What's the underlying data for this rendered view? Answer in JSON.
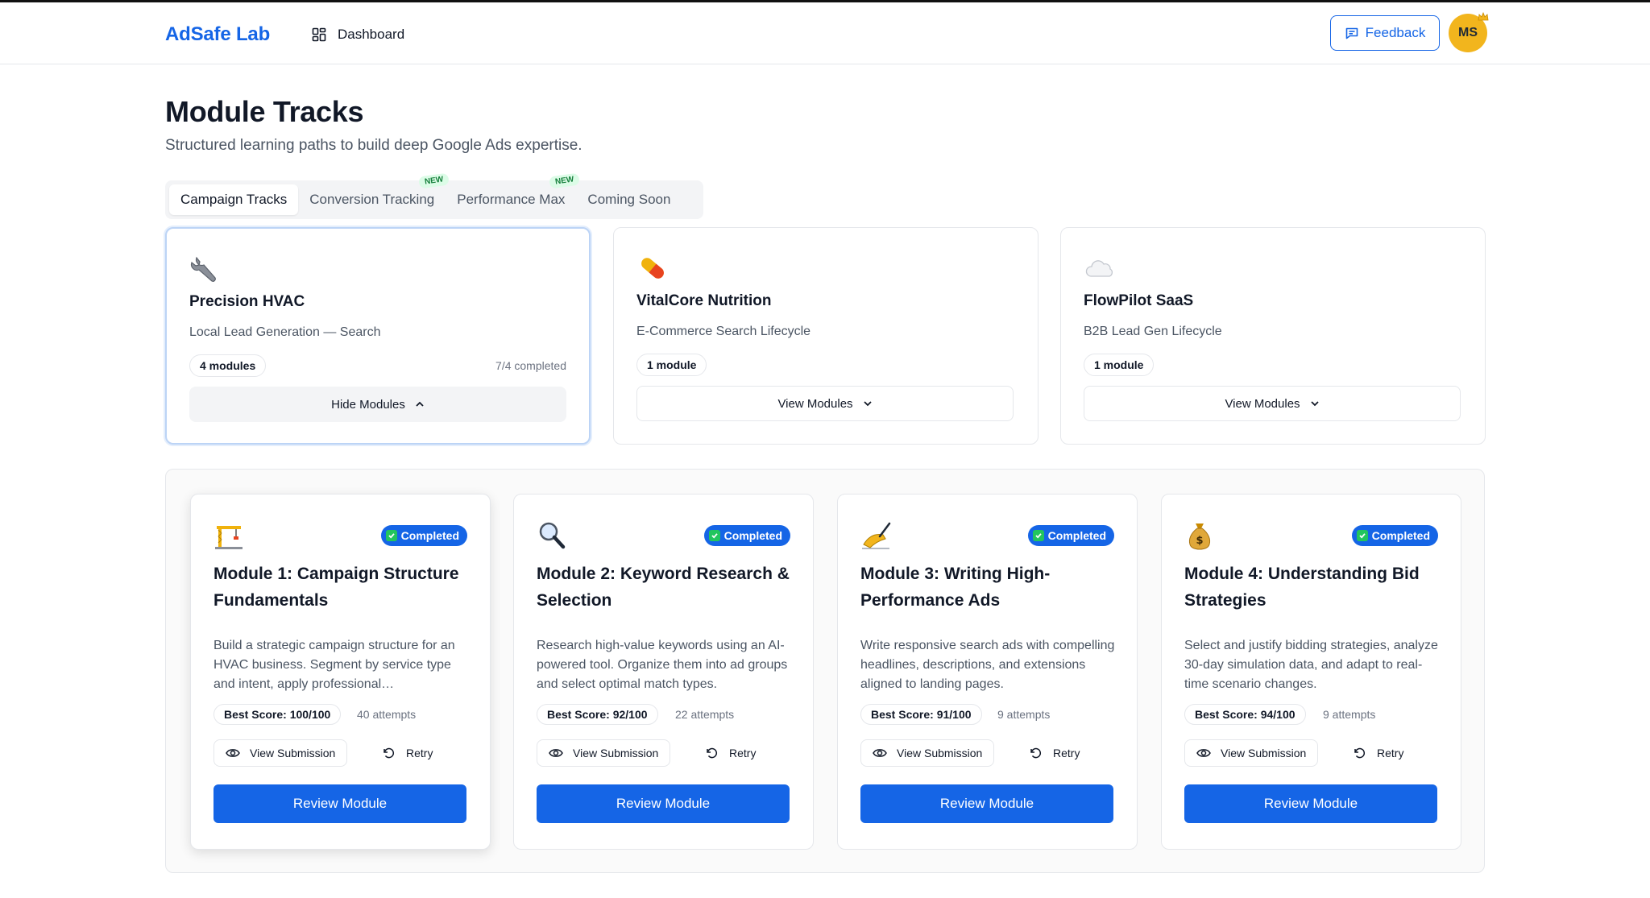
{
  "header": {
    "brand": "AdSafe Lab",
    "nav_dashboard": "Dashboard",
    "feedback_label": "Feedback",
    "avatar_initials": "MS"
  },
  "page": {
    "title": "Module Tracks",
    "subtitle": "Structured learning paths to build deep Google Ads expertise."
  },
  "tabs": [
    {
      "label": "Campaign Tracks",
      "active": true,
      "badge": ""
    },
    {
      "label": "Conversion Tracking",
      "active": false,
      "badge": "NEW"
    },
    {
      "label": "Performance Max",
      "active": false,
      "badge": "NEW"
    },
    {
      "label": "Coming Soon",
      "active": false,
      "badge": ""
    }
  ],
  "tracks": [
    {
      "icon": "wrench-icon",
      "name": "Precision HVAC",
      "description": "Local Lead Generation — Search",
      "modules": "4 modules",
      "progress": "7/4 completed",
      "button": "Hide Modules"
    },
    {
      "icon": "pill-icon",
      "name": "VitalCore Nutrition",
      "description": "E-Commerce Search Lifecycle",
      "modules": "1 module",
      "progress": "",
      "button": "View Modules"
    },
    {
      "icon": "cloud-icon",
      "name": "FlowPilot SaaS",
      "description": "B2B Lead Gen Lifecycle",
      "modules": "1 module",
      "progress": "",
      "button": "View Modules"
    }
  ],
  "modules": [
    {
      "icon": "construction-crane-icon",
      "status": "Completed",
      "title": "Module 1: Campaign Structure Fundamentals",
      "description": "Build a strategic campaign structure for an HVAC business. Segment by service type and intent, apply professional…",
      "best_score": "Best Score: 100/100",
      "attempts": "40 attempts",
      "view_label": "View Submission",
      "retry_label": "Retry",
      "review_label": "Review Module"
    },
    {
      "icon": "magnifier-icon",
      "status": "Completed",
      "title": "Module 2: Keyword Research & Selection",
      "description": "Research high-value keywords using an AI-powered tool. Organize them into ad groups and select optimal match types.",
      "best_score": "Best Score: 92/100",
      "attempts": "22 attempts",
      "view_label": "View Submission",
      "retry_label": "Retry",
      "review_label": "Review Module"
    },
    {
      "icon": "writing-hand-icon",
      "status": "Completed",
      "title": "Module 3: Writing High-Performance Ads",
      "description": "Write responsive search ads with compelling headlines, descriptions, and extensions aligned to landing pages.",
      "best_score": "Best Score: 91/100",
      "attempts": "9 attempts",
      "view_label": "View Submission",
      "retry_label": "Retry",
      "review_label": "Review Module"
    },
    {
      "icon": "money-bag-icon",
      "status": "Completed",
      "title": "Module 4: Understanding Bid Strategies",
      "description": "Select and justify bidding strategies, analyze 30-day simulation data, and adapt to real-time scenario changes.",
      "best_score": "Best Score: 94/100",
      "attempts": "9 attempts",
      "view_label": "View Submission",
      "retry_label": "Retry",
      "review_label": "Review Module"
    }
  ],
  "colors": {
    "accent": "#1565e6",
    "avatar": "#f2b51d",
    "new_badge": "#16803c",
    "check": "#22c55e"
  }
}
